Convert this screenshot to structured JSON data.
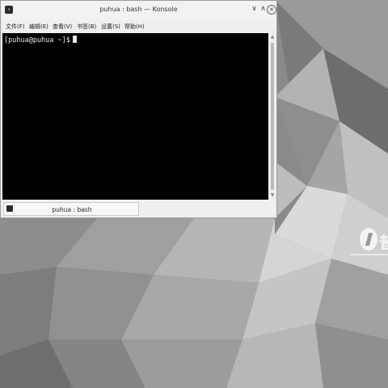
{
  "window": {
    "title": "puhua : bash — Konsole",
    "app_icon": "konsole-icon",
    "buttons": {
      "minimize": "∨",
      "maximize": "∧",
      "close": "×"
    }
  },
  "menubar": {
    "items": [
      {
        "label": "文件(F)"
      },
      {
        "label": "编辑(E)"
      },
      {
        "label": "查看(V)"
      },
      {
        "label": "书签(B)"
      },
      {
        "label": "设置(S)"
      },
      {
        "label": "帮助(H)"
      }
    ]
  },
  "terminal": {
    "prompt": "[puhua@puhua ~]$"
  },
  "tabs": [
    {
      "label": "puhua : bash"
    }
  ],
  "desktop": {
    "brand_text": "普",
    "colors": {
      "background": "#8a8a8a",
      "terminal_bg": "#000000",
      "text": "#e8e8e8"
    }
  }
}
